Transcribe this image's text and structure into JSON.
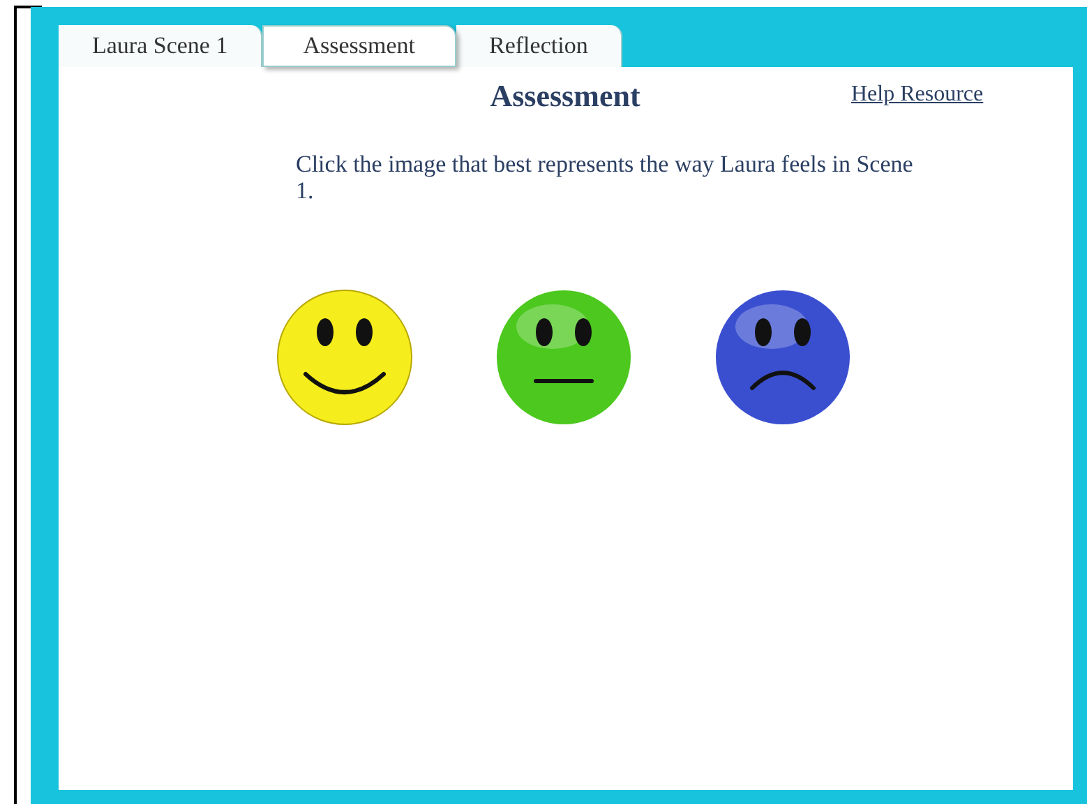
{
  "tabs": [
    {
      "label": "Laura Scene 1",
      "selected": false
    },
    {
      "label": "Assessment",
      "selected": true
    },
    {
      "label": "Reflection",
      "selected": false
    }
  ],
  "heading": "Assessment",
  "help_link": "Help Resource",
  "instruction": "Click the image that best represents the way Laura feels in Scene 1.",
  "faces": [
    {
      "kind": "happy",
      "color": "#f5ee1c"
    },
    {
      "kind": "neutral",
      "color": "#4cc81e"
    },
    {
      "kind": "sad",
      "color": "#3a4fd0"
    }
  ]
}
